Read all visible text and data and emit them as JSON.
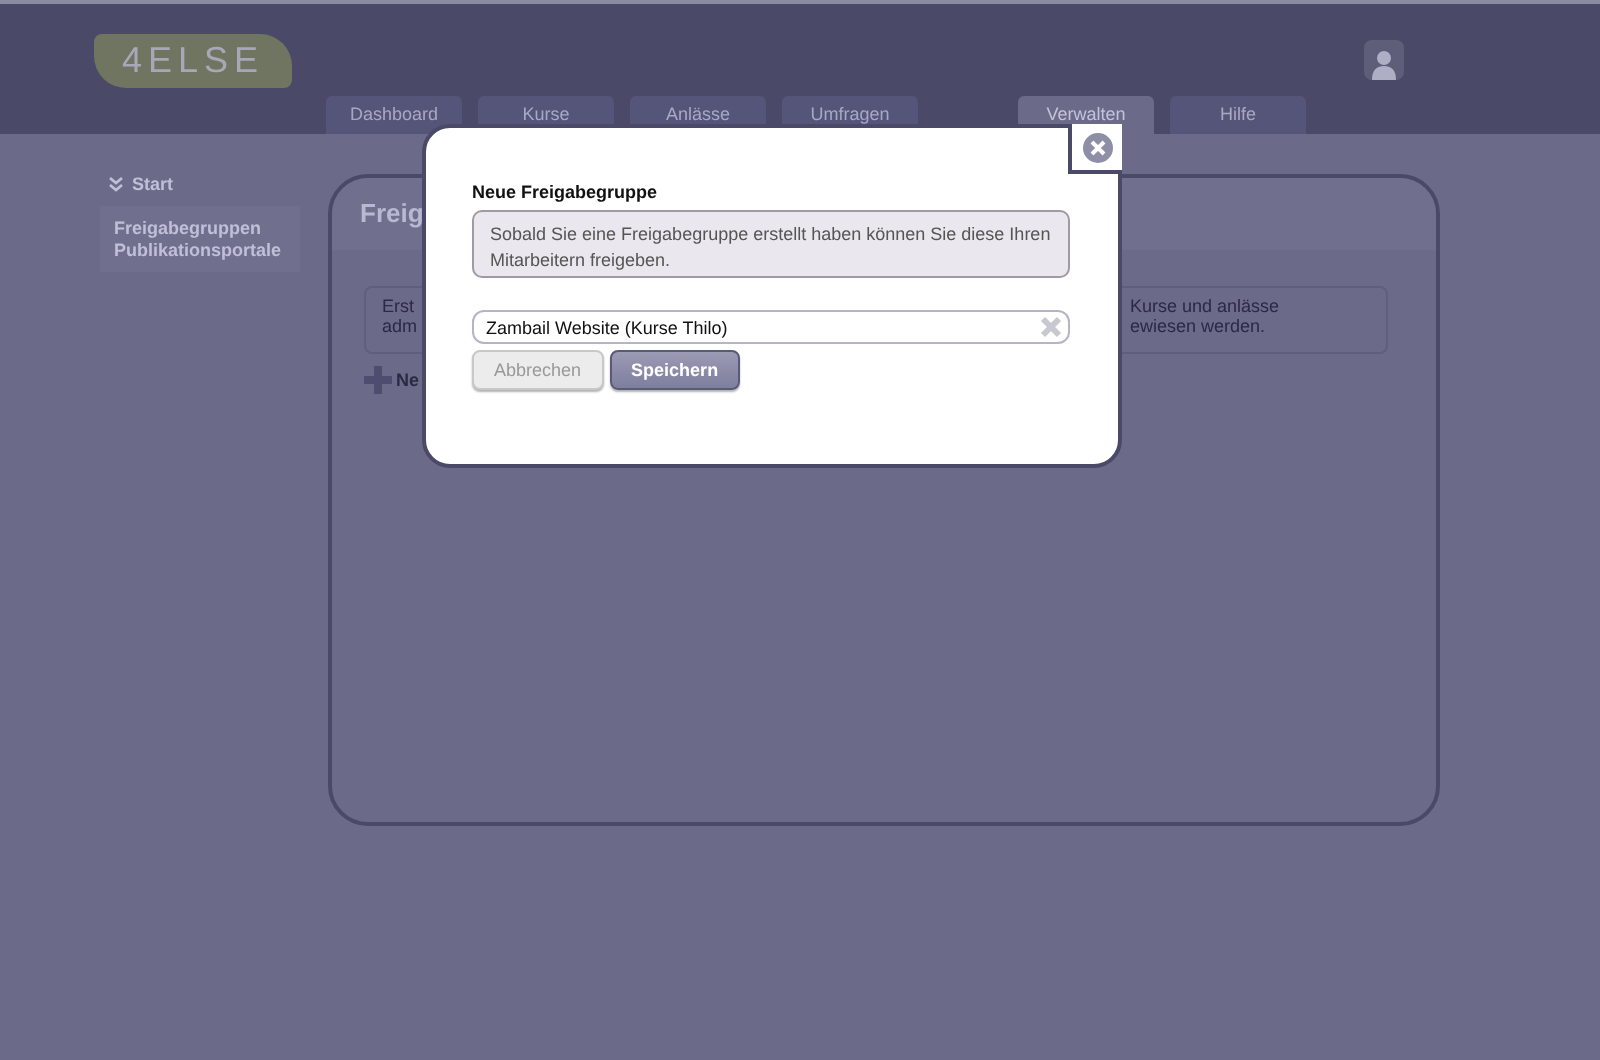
{
  "logo": "4ELSE",
  "tabs": [
    {
      "label": "Dashboard",
      "selected": false
    },
    {
      "label": "Kurse",
      "selected": false
    },
    {
      "label": "Anlässe",
      "selected": false
    },
    {
      "label": "Umfragen",
      "selected": false
    },
    {
      "label": "Verwalten",
      "selected": true
    },
    {
      "label": "Hilfe",
      "selected": false
    }
  ],
  "sidebar": {
    "heading": "Start",
    "items": [
      "Freigabegruppen",
      "Publikationsportale"
    ]
  },
  "card": {
    "title": "Freig",
    "info_left": [
      "Erst",
      "adm"
    ],
    "info_right": [
      "Kurse und anlässe",
      "ewiesen werden."
    ],
    "add_label": "Ne"
  },
  "dialog": {
    "title": "Neue Freigabegruppe",
    "hint": "Sobald Sie eine Freigabegruppe erstellt haben können Sie diese Ihren Mitarbeitern freigeben.",
    "name_value": "Zambail Website (Kurse Thilo)",
    "buttons": [
      {
        "label": "Abbrechen",
        "kind": "cancel"
      },
      {
        "label": "Speichern",
        "kind": "save"
      }
    ]
  }
}
